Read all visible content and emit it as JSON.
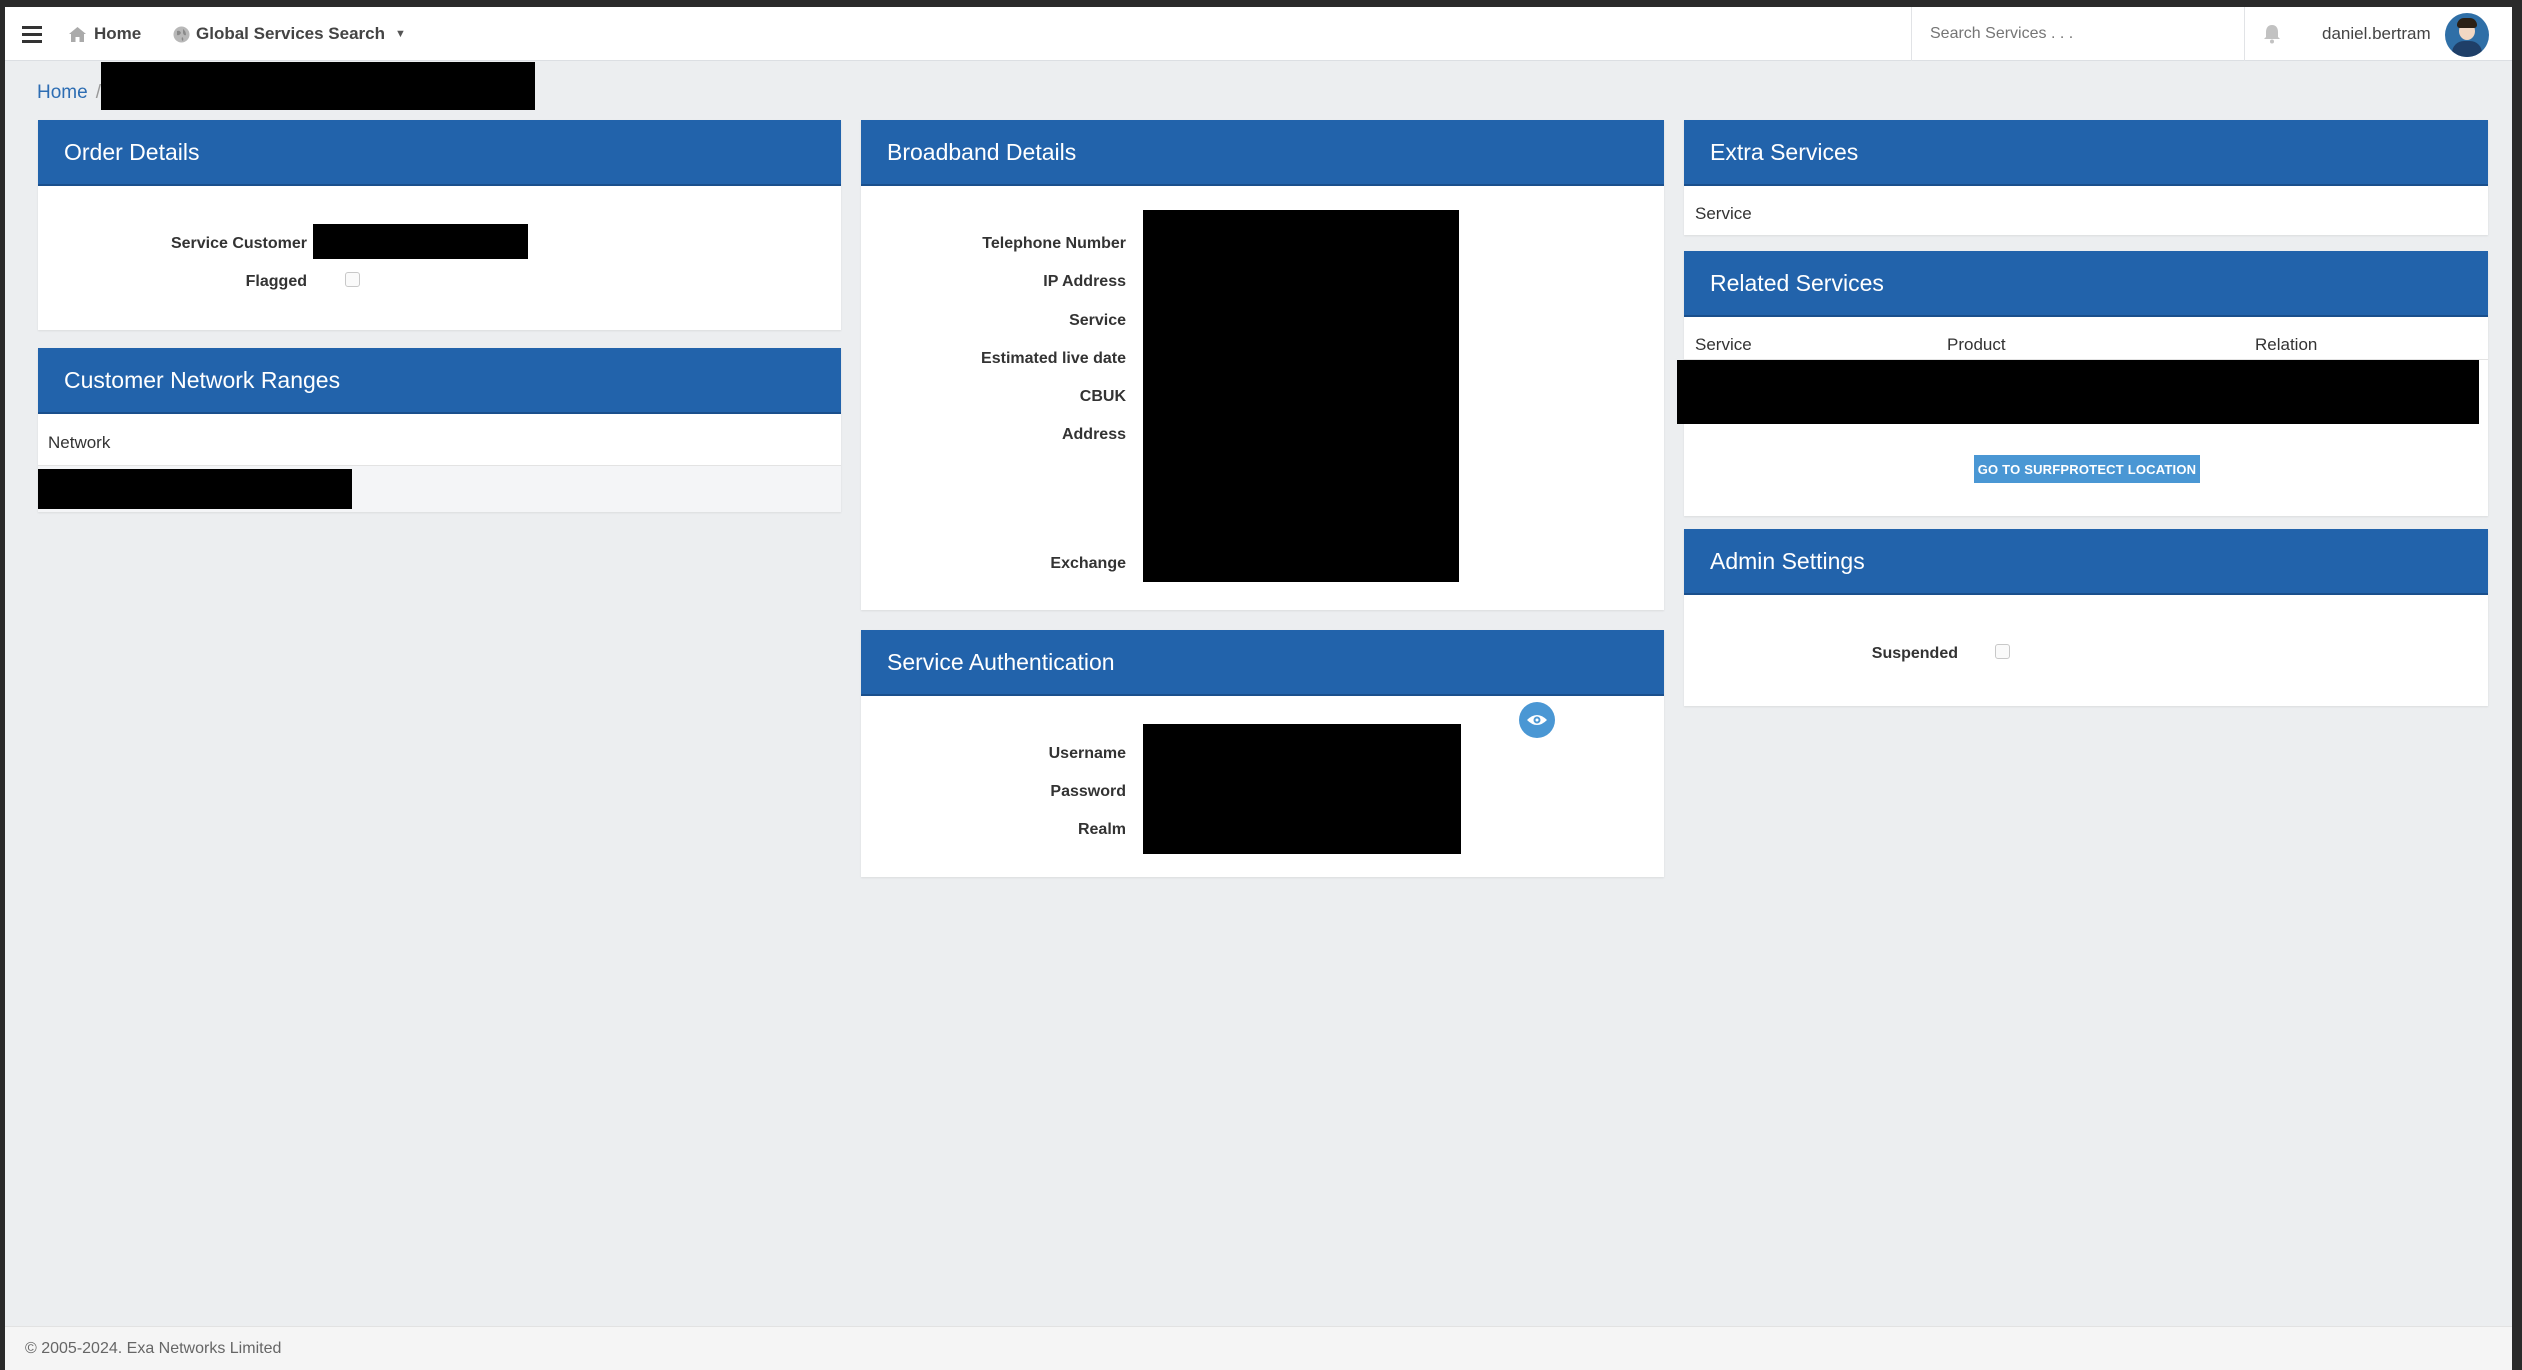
{
  "nav": {
    "home_label": "Home",
    "global_search_label": "Global Services Search",
    "search_placeholder": "Search Services . . .",
    "username": "daniel.bertram"
  },
  "breadcrumb": {
    "home": "Home",
    "separator": "/"
  },
  "order_details": {
    "title": "Order Details",
    "service_customer_label": "Service Customer",
    "flagged_label": "Flagged",
    "flagged": false
  },
  "customer_network_ranges": {
    "title": "Customer Network Ranges",
    "columns": [
      "Network"
    ]
  },
  "broadband_details": {
    "title": "Broadband Details",
    "labels": [
      "Telephone Number",
      "IP Address",
      "Service",
      "Estimated live date",
      "CBUK",
      "Address",
      "Exchange"
    ]
  },
  "service_authentication": {
    "title": "Service Authentication",
    "labels": [
      "Username",
      "Password",
      "Realm"
    ]
  },
  "extra_services": {
    "title": "Extra Services",
    "columns": [
      "Service"
    ]
  },
  "related_services": {
    "title": "Related Services",
    "columns": [
      "Service",
      "Product",
      "Relation"
    ],
    "button_label": "GO TO SURFPROTECT LOCATION"
  },
  "admin_settings": {
    "title": "Admin Settings",
    "suspended_label": "Suspended",
    "suspended": false
  },
  "footer": {
    "copyright": "© 2005-2024. Exa Networks Limited"
  },
  "colors": {
    "header_blue": "#2263ab",
    "accent_blue": "#4a97d4",
    "link_blue": "#2d6db3"
  }
}
